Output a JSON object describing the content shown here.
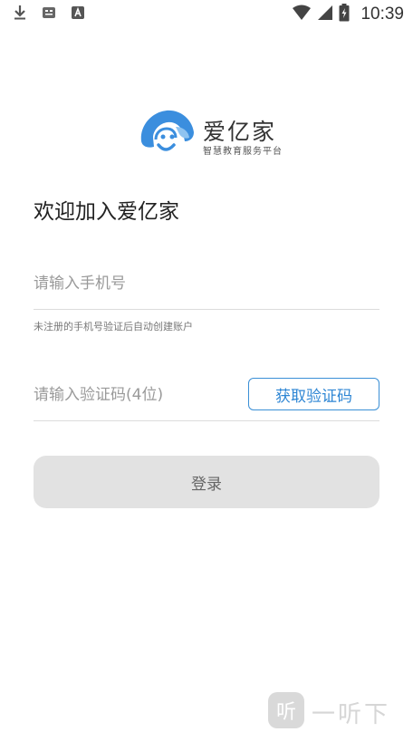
{
  "status_bar": {
    "time": "10:39",
    "left_icons": [
      "download-icon",
      "notification-icon",
      "font-app-icon"
    ],
    "right_icons": [
      "wifi-icon",
      "cell-signal-icon",
      "battery-charging-icon"
    ]
  },
  "logo": {
    "title": "爱亿家",
    "subtitle": "智慧教育服务平台",
    "colors": {
      "mark_blue": "#3b8ede",
      "mark_light": "#8fc3f0"
    }
  },
  "welcome": "欢迎加入爱亿家",
  "phone": {
    "placeholder": "请输入手机号",
    "value": ""
  },
  "hint": "未注册的手机号验证后自动创建账户",
  "code": {
    "placeholder": "请输入验证码(4位)",
    "value": "",
    "button_label": "获取验证码"
  },
  "login_label": "登录",
  "watermark": {
    "badge": "听",
    "text": "一听下载"
  },
  "colors": {
    "accent": "#2e86d4",
    "button_disabled": "#e2e2e2"
  }
}
